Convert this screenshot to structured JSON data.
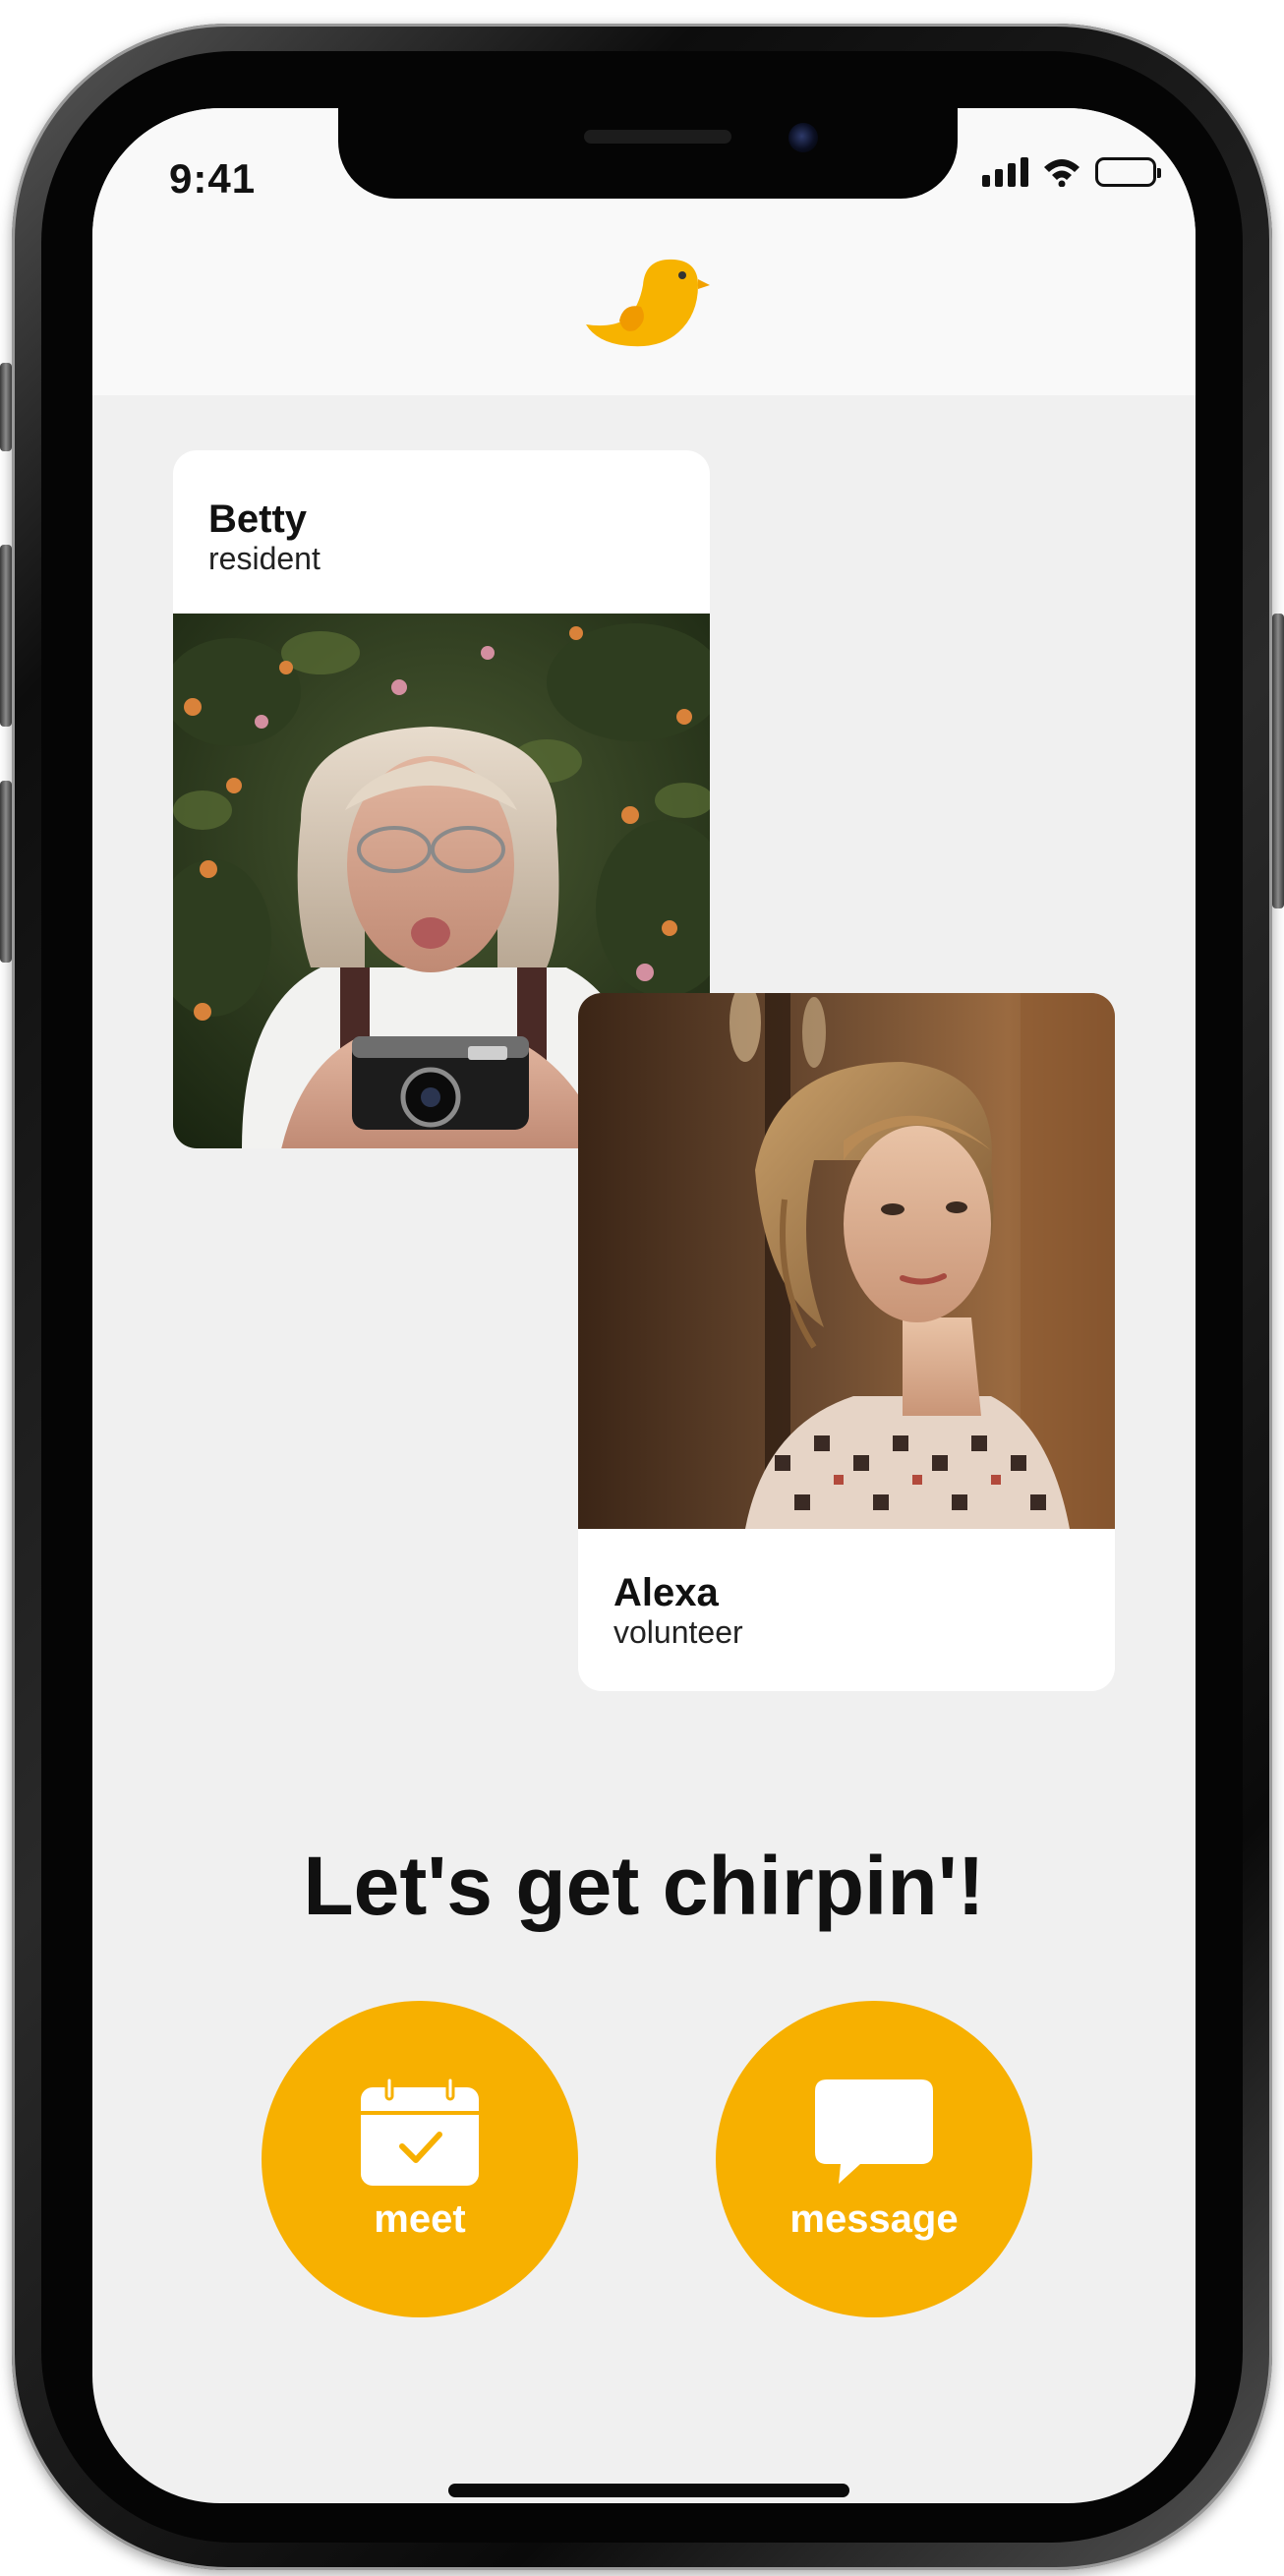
{
  "status_bar": {
    "time": "9:41"
  },
  "header": {
    "logo_icon": "bird-logo-icon"
  },
  "cards": [
    {
      "name": "Betty",
      "role": "resident",
      "photo": "older-woman-with-camera"
    },
    {
      "name": "Alexa",
      "role": "volunteer",
      "photo": "young-woman-portrait"
    }
  ],
  "headline": "Let's get chirpin'!",
  "actions": [
    {
      "label": "meet",
      "icon": "calendar-check-icon"
    },
    {
      "label": "message",
      "icon": "chat-bubble-icon"
    }
  ],
  "colors": {
    "accent": "#F7B000",
    "background": "#F0F0F0",
    "header": "#F9F9F9"
  }
}
